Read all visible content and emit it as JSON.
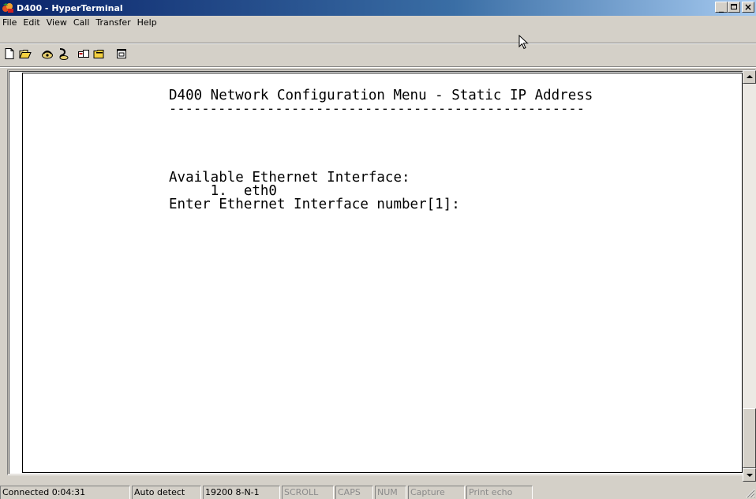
{
  "window": {
    "title": "D400 - HyperTerminal",
    "icon": "hyperterminal-icon",
    "controls": [
      "minimize",
      "restore",
      "close"
    ]
  },
  "menu": {
    "items": [
      "File",
      "Edit",
      "View",
      "Call",
      "Transfer",
      "Help"
    ]
  },
  "toolbar": {
    "buttons": [
      "new-icon",
      "open-icon",
      "connect-icon",
      "disconnect-icon",
      "send-icon",
      "receive-icon",
      "properties-icon"
    ]
  },
  "terminal": {
    "lines": [
      "D400 Network Configuration Menu - Static IP Address",
      "---------------------------------------------------",
      "Available Ethernet Interface:",
      "     1.  eth0",
      "Enter Ethernet Interface number[1]:"
    ]
  },
  "statusbar": {
    "connected": "Connected 0:04:31",
    "detect": "Auto detect",
    "port": "19200 8-N-1",
    "scroll": "SCROLL",
    "caps": "CAPS",
    "num": "NUM",
    "capture": "Capture",
    "print_echo": "Print echo"
  },
  "colors": {
    "titlebar_start": "#0a246a",
    "titlebar_end": "#a6caf0",
    "chrome": "#d4d0c8",
    "terminal_bg": "#ffffff",
    "terminal_text": "#000000"
  }
}
